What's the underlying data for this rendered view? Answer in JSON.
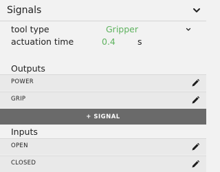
{
  "header": {
    "title": "Signals",
    "toggle_icon": "chevron-down-icon"
  },
  "properties": {
    "tool_type": {
      "label": "tool type",
      "value": "Gripper",
      "dropdown_icon": "chevron-down-icon"
    },
    "actuation_time": {
      "label": "actuation time",
      "value": "0.4",
      "unit": "s"
    }
  },
  "outputs": {
    "title": "Outputs",
    "items": [
      {
        "label": "POWER",
        "action_icon": "pencil-icon"
      },
      {
        "label": "GRIP",
        "action_icon": "pencil-icon"
      }
    ]
  },
  "add_signal_button": {
    "label": "+ SIGNAL"
  },
  "inputs": {
    "title": "Inputs",
    "items": [
      {
        "label": "OPEN",
        "action_icon": "pencil-icon"
      },
      {
        "label": "CLOSED",
        "action_icon": "pencil-icon"
      }
    ]
  },
  "colors": {
    "value_accent": "#5fb35f",
    "panel_background": "#f2f2f2",
    "row_background": "#e9e9e9",
    "button_background": "#6a6a6a"
  }
}
